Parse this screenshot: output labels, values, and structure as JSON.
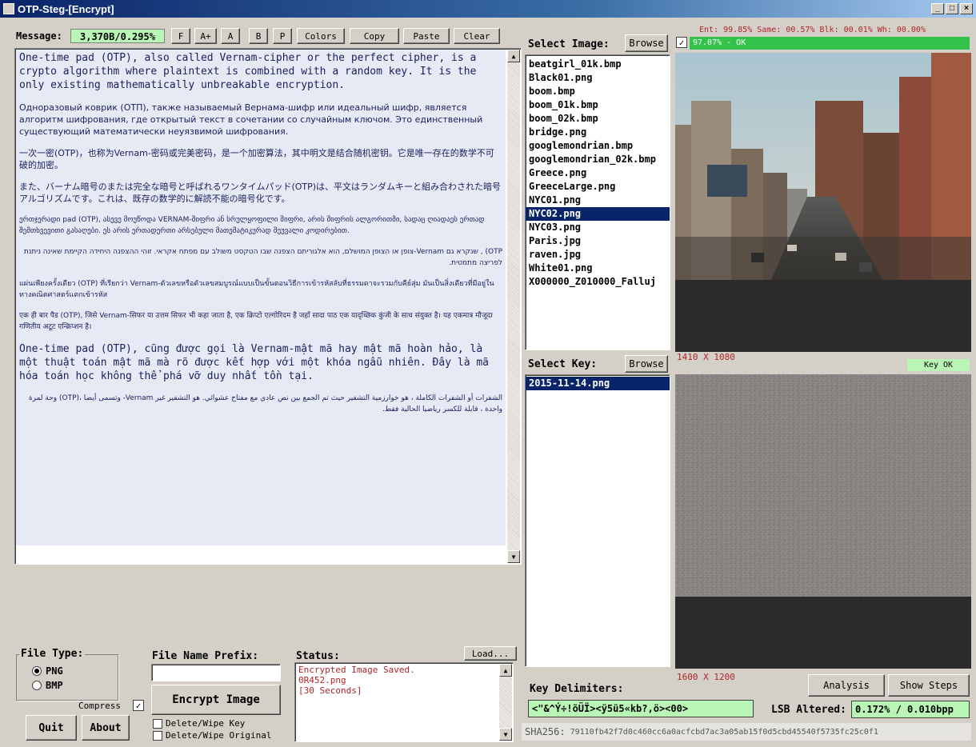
{
  "window": {
    "title": "OTP-Steg-[Encrypt]",
    "min": "_",
    "max": "□",
    "close": "×"
  },
  "message": {
    "label": "Message:",
    "size_badge": "3,370B/0.295%",
    "toolbar": [
      "F",
      "A+",
      "A",
      "B",
      "P",
      "Colors",
      "Copy",
      "Paste",
      "Clear"
    ],
    "paragraphs": [
      "One-time pad (OTP), also called Vernam-cipher or the perfect cipher, is a crypto algorithm where plaintext is combined with a random key. It is the only existing mathematically unbreakable encryption.",
      "Одноразовый коврик (ОТП), также называемый Вернама-шифр или идеальный шифр, является алгоритм шифрования, где открытый текст в сочетании со случайным ключом. Это единственный существующий математически неуязвимой шифрования.",
      "一次一密(OTP)，也称为Vernam-密码或完美密码，是一个加密算法，其中明文是结合随机密钥。它是唯一存在的数学不可破的加密。",
      "また、バーナム暗号のまたは完全な暗号と呼ばれるワンタイムパッド(OTP)は、平文はランダムキーと組み合わされた暗号アルゴリズムです。これは、既存の数学的に解読不能の暗号化です。",
      "ერთჯერადი pad (OTP), ასევე მოუწოდა VERNAM-შიფრი ან სრულყოფილი შიფრი, არის შიფრის ალგორითმი, სადაც ღიადაეს ერთად შემთხვევითი გასაღები. ეს არის ერთადერთი არსებული მათემატიკურად შეუვალი კოდირებით.",
      "OTP) , שנקרא גם Vernam-צופן או הצופן המושלם, הוא אלגוריתם הצפנה שבו הטקסט משולב עם מפתח אקראי. זוהי ההצפנה היחידה הקיימת שאינה ניתנת לפריצה מתמטית.",
      "แผ่นเพียงครั้งเดียว (OTP) ที่เรียกว่า Vernam-ตัวเลขหรือตัวเลขสมบูรณ์แบบเป็นขั้นตอนวิธีการเข้ารหัสลับที่ธรรมดาจะรวมกับคีย์สุ่ม มันเป็นสิ่งเดียวที่มีอยู่ในทางคณิตศาสตร์แตกเข้ารหัส",
      "एक ही बार पैड (OTP), जिसे Vernam-सिफर या उत्तम सिफर भी कहा जाता है, एक क्रिप्टो एल्गोरिदम है जहाँ सादा पाठ एक यादृच्छिक कुंजी के साथ संयुक्त है। यह एकमात्र मौजूदा गणितीय अटूट एन्क्रिप्शन है।",
      "One-time pad (OTP), cũng được gọi là Vernam-mật mã hay mật mã hoàn hảo, là một thuật toán mật mã mà rõ được kết hợp với một khóa ngẫu nhiên. Đây là mã hóa toán học không thể phá vỡ duy nhất tồn tại.",
      "الشفرات أو الشفرات الكاملة ، هو خوارزمية التشفير حيث تم الجمع بين نص عادي مع مفتاح عشوائي. هو التشفير غير Vernam- وتسمى أيضا ،(OTP) وحة لمرة واحدة ، قابلة للكسر رياضيا الحالية فقط."
    ]
  },
  "file_type": {
    "label": "File Type:",
    "options": [
      "PNG",
      "BMP"
    ],
    "selected": "PNG",
    "compress_label": "Compress"
  },
  "prefix": {
    "label": "File Name Prefix:",
    "value": ""
  },
  "buttons": {
    "encrypt": "Encrypt Image",
    "quit": "Quit",
    "about": "About",
    "load": "Load...",
    "browse_image": "Browse",
    "browse_key": "Browse",
    "analysis": "Analysis",
    "show_steps": "Show Steps"
  },
  "wipe": {
    "key": "Delete/Wipe Key",
    "original": "Delete/Wipe Original"
  },
  "status": {
    "label": "Status:",
    "lines": [
      "Encrypted Image Saved.",
      "0R452.png",
      "[30 Seconds]"
    ]
  },
  "image_select": {
    "label": "Select Image:",
    "files": [
      "beatgirl_01k.bmp",
      "Black01.png",
      "boom.bmp",
      "boom_01k.bmp",
      "boom_02k.bmp",
      "bridge.png",
      "googlemondrian.bmp",
      "googlemondrian_02k.bmp",
      "Greece.png",
      "GreeceLarge.png",
      "NYC01.png",
      "NYC02.png",
      "NYC03.png",
      "Paris.jpg",
      "raven.jpg",
      "White01.png",
      "X000000_Z010000_Falluj"
    ],
    "selected": "NYC02.png"
  },
  "stats": {
    "line": "Ent: 99.85% Same: 00.57% Blk: 00.01% Wh: 00.00%",
    "ok": "97.07% - OK"
  },
  "image_dims": "1410 X 1080",
  "key_select": {
    "label": "Select Key:",
    "files": [
      "2015-11-14.png"
    ],
    "selected": "2015-11-14.png",
    "status": "Key OK"
  },
  "key_dims": "1600 X 1200",
  "delimiters": {
    "label": "Key Delimiters:",
    "value": "<\"&^Ý÷!õÜÏ><ÿ5ü5«kb?,ö><00>"
  },
  "lsb": {
    "label": "LSB Altered:",
    "value": "0.172% / 0.010bpp"
  },
  "sha": {
    "label": "SHA256:",
    "value": "79110fb42f7d0c460cc6a0acfcbd7ac3a05ab15f0d5cbd45540f5735fc25c0f1"
  }
}
